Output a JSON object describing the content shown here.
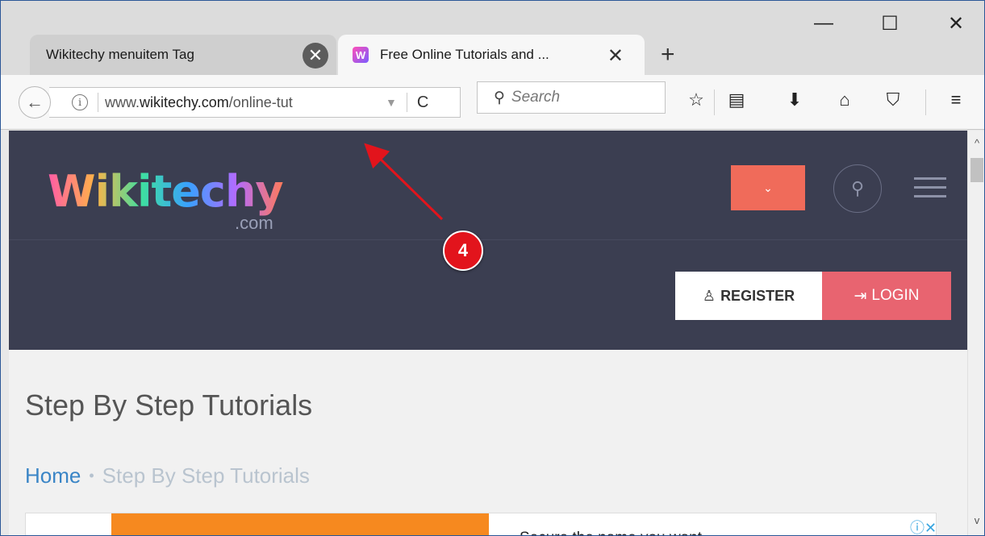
{
  "window": {
    "minimize": "—",
    "maximize": "☐",
    "close": "✕"
  },
  "tabs": [
    {
      "title": "Wikitechy menuitem Tag",
      "close": "✕"
    },
    {
      "title": "Free Online Tutorials and ...",
      "favicon": "W",
      "close": "✕"
    }
  ],
  "new_tab": "+",
  "navbar": {
    "back": "←",
    "info": "i",
    "url_plain_prefix": "www.",
    "url_domain": "wikitechy.com",
    "url_path": "/online-tut",
    "url_dropdown": "▼",
    "reload": "C",
    "search_placeholder": "Search",
    "search_icon": "⚲",
    "icons": {
      "bookmark": "☆",
      "reading_list": "▤",
      "downloads": "⬇",
      "home": "⌂",
      "pocket": "⛉",
      "menu": "≡"
    }
  },
  "site": {
    "logo": "Wikitechy",
    "logo_suffix": ".com",
    "dropdown_chevron": "⌄",
    "search_icon": "⚲",
    "register_icon": "♙",
    "register_label": "REGISTER",
    "login_icon": "⇥",
    "login_label": "LOGIN"
  },
  "page": {
    "title": "Step By Step Tutorials",
    "breadcrumb_home": "Home",
    "breadcrumb_sep": "•",
    "breadcrumb_current": "Step By Step Tutorials"
  },
  "ad": {
    "text": "Secure the name you want",
    "choices": "ⓘ✕"
  },
  "scrollbar": {
    "up": "^",
    "down": "v"
  },
  "annotation": {
    "badge": "4",
    "badge_color": "#e2141c",
    "arrow_color": "#e2141c"
  },
  "colors": {
    "header_bg": "#3b3e51",
    "dropdown_btn": "#f06b5a",
    "login_btn": "#e86470",
    "link": "#3a85c6",
    "ad_orange": "#f6891f"
  }
}
